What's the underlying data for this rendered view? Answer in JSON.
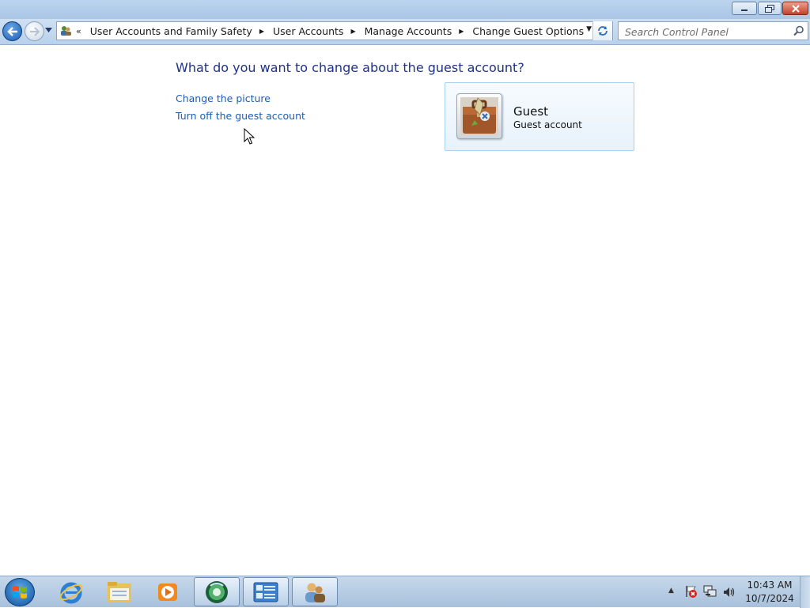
{
  "window": {
    "minimize_icon": "minimize-icon",
    "maximize_icon": "restore-icon",
    "close_icon": "close-icon"
  },
  "navbar": {
    "back_icon": "back-arrow-icon",
    "forward_icon": "forward-arrow-icon",
    "breadcrumb_overflow": "«",
    "breadcrumbs": [
      "User Accounts and Family Safety",
      "User Accounts",
      "Manage Accounts",
      "Change Guest Options"
    ],
    "refresh_icon": "refresh-icon",
    "search_placeholder": "Search Control Panel",
    "search_icon": "magnifier-icon"
  },
  "content": {
    "heading": "What do you want to change about the guest account?",
    "tasks": [
      "Change the picture",
      "Turn off the guest account"
    ],
    "account": {
      "name": "Guest",
      "type": "Guest account",
      "picture_icon": "briefcase-icon"
    }
  },
  "taskbar": {
    "items": [
      "start-orb-icon",
      "internet-explorer-icon",
      "file-explorer-icon",
      "media-player-icon",
      "media-center-icon",
      "control-panel-icon",
      "user-accounts-icon"
    ],
    "tray": [
      "action-center-flag-icon",
      "network-icon",
      "volume-icon"
    ],
    "clock_time": "10:43 AM",
    "clock_date": "10/7/2024"
  },
  "colors": {
    "heading": "#1e3287",
    "link": "#1d5dae",
    "card_border": "#a8d1ee"
  }
}
